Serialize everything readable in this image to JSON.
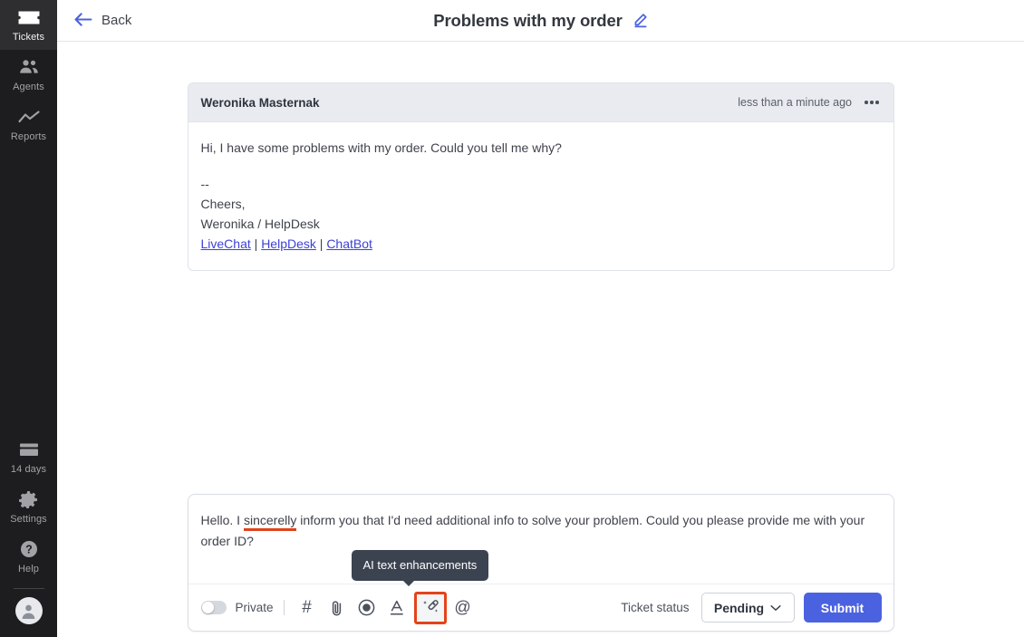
{
  "sidebar": {
    "top_items": [
      {
        "label": "Tickets",
        "icon": "ticket-icon",
        "active": true
      },
      {
        "label": "Agents",
        "icon": "agents-icon",
        "active": false
      },
      {
        "label": "Reports",
        "icon": "reports-icon",
        "active": false
      }
    ],
    "bottom_items": [
      {
        "label": "14 days",
        "icon": "trial-card-icon"
      },
      {
        "label": "Settings",
        "icon": "gear-icon"
      },
      {
        "label": "Help",
        "icon": "question-circle-icon"
      }
    ],
    "avatar": {
      "icon": "user-avatar-icon"
    },
    "bg_color": "#1D1D1F",
    "active_bg_color": "#2E2E31"
  },
  "topbar": {
    "back_label": "Back",
    "back_icon": "arrow-left-icon",
    "ticket_title": "Problems with my order",
    "edit_icon": "pencil-icon",
    "accent_color": "#4b62e0"
  },
  "message": {
    "author": "Weronika Masternak",
    "timestamp": "less than a minute ago",
    "more_icon": "ellipsis-icon",
    "body_line_1": "Hi, I have some problems with my order. Could you tell me why?",
    "signature_dashes": "--",
    "signature_line_1": "Cheers,",
    "signature_line_2": "Weronika / HelpDesk",
    "links": [
      {
        "label": "LiveChat"
      },
      {
        "label": "HelpDesk"
      },
      {
        "label": "ChatBot"
      }
    ],
    "link_separator": "|",
    "header_bg": "#e9ebf0",
    "link_color": "#3d41d8"
  },
  "composer": {
    "reply_text_before": "Hello. I ",
    "reply_text_misspelled": "sincerelly",
    "reply_text_after": " inform you that I'd need additional info to solve your problem. Could you please provide me with your order ID?",
    "spellcheck_underline_color": "#e0421a",
    "toolbar": {
      "private_toggle": {
        "label": "Private",
        "state": "off"
      },
      "buttons": [
        {
          "name": "hashtag-icon",
          "glyph": "#",
          "title": "Canned response"
        },
        {
          "name": "paperclip-icon",
          "glyph": "",
          "title": "Attachment"
        },
        {
          "name": "record-circle-icon",
          "glyph": "",
          "title": "Record"
        },
        {
          "name": "text-format-icon",
          "glyph": "",
          "title": "Text formatting"
        },
        {
          "name": "magic-wand-icon",
          "glyph": "",
          "title": "AI text enhancements"
        },
        {
          "name": "mention-at-icon",
          "glyph": "@",
          "title": "Mention"
        }
      ],
      "highlighted_button": "magic-wand-icon",
      "highlight_color": "#e5431a",
      "tooltip": "AI text enhancements",
      "status_label": "Ticket status",
      "status_value": "Pending",
      "status_chevron_icon": "chevron-down-icon",
      "submit_label": "Submit",
      "submit_color": "#4b62e0"
    }
  }
}
